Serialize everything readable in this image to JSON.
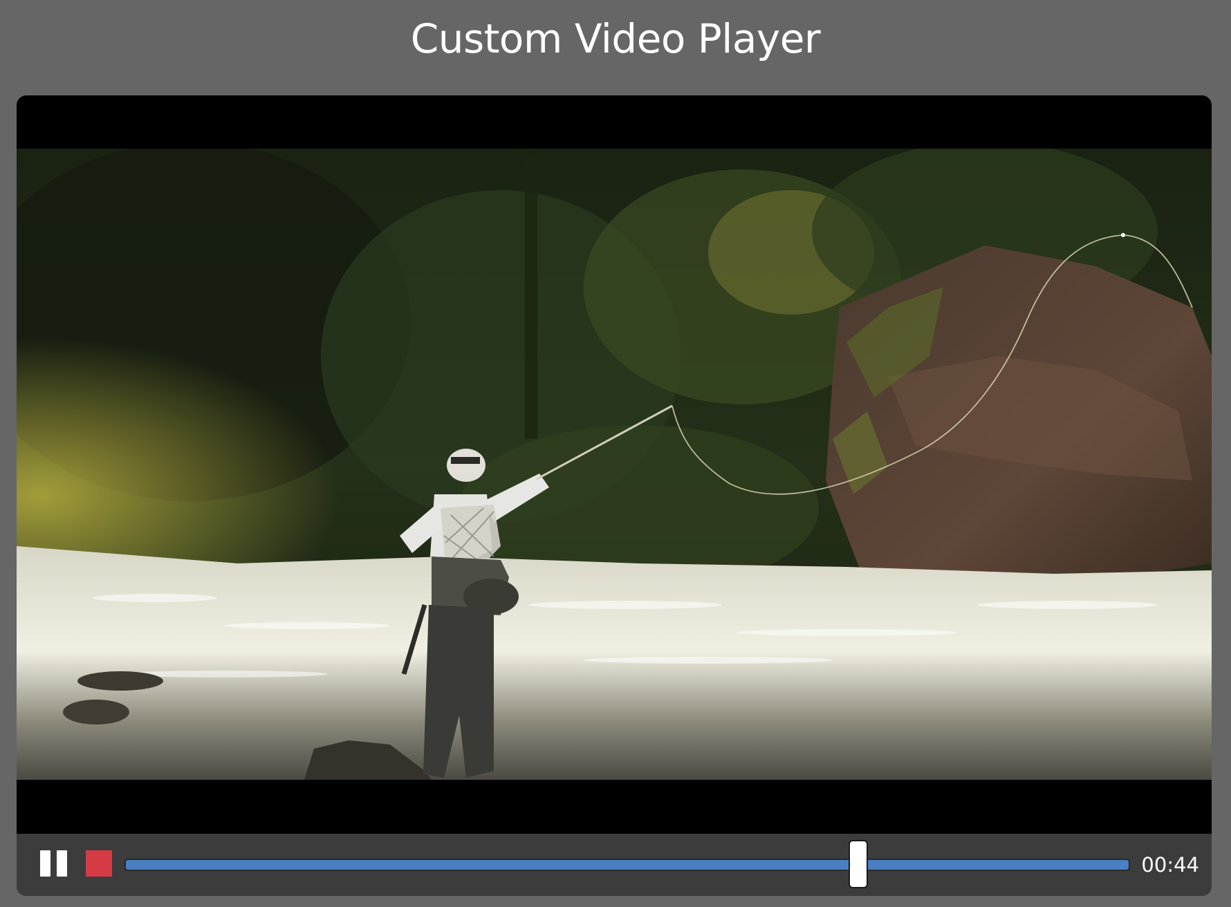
{
  "page": {
    "title": "Custom Video Player"
  },
  "player": {
    "video": {
      "scene": "fly-fisherman-casting-in-river"
    },
    "controls": {
      "pause_icon": "pause-icon",
      "stop_icon": "stop-icon",
      "progress_fraction": 0.73,
      "time": "00:44"
    }
  },
  "colors": {
    "page_background": "#666666",
    "player_background": "#000000",
    "controls_background": "#3c3c3c",
    "progress_fill": "#4a7fc1",
    "stop_button": "#d63b45",
    "text": "#ffffff"
  }
}
